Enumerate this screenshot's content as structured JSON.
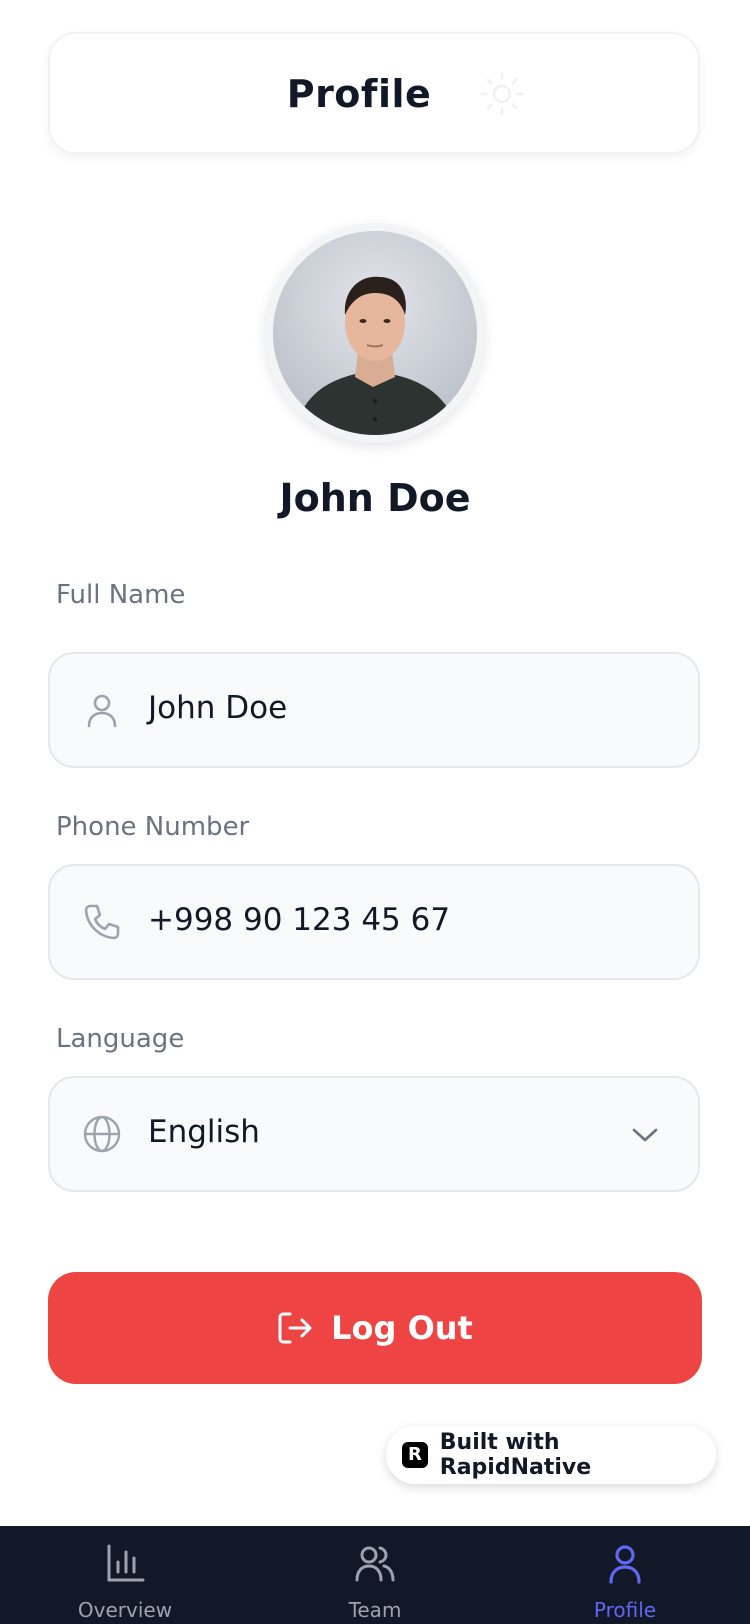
{
  "header": {
    "title": "Profile",
    "theme_icon": "sun-icon"
  },
  "profile": {
    "name": "John Doe",
    "avatar_icon": "user-photo"
  },
  "fields": {
    "full_name": {
      "label": "Full Name",
      "value": "John Doe",
      "icon": "user-icon"
    },
    "phone": {
      "label": "Phone Number",
      "value": "+998 90 123 45 67",
      "icon": "phone-icon"
    },
    "language": {
      "label": "Language",
      "value": "English",
      "icon": "globe-icon",
      "dropdown_icon": "chevron-down-icon"
    }
  },
  "logout": {
    "label": "Log Out",
    "icon": "logout-icon",
    "color": "#ef4444"
  },
  "badge": {
    "text": "Built with RapidNative",
    "logo": "R"
  },
  "tabbar": {
    "tabs": [
      {
        "label": "Overview",
        "icon": "bar-chart-icon",
        "active": false
      },
      {
        "label": "Team",
        "icon": "users-icon",
        "active": false
      },
      {
        "label": "Profile",
        "icon": "user-icon",
        "active": true
      }
    ],
    "active_color": "#6366f1",
    "inactive_color": "#9ca3af",
    "background": "#111827"
  }
}
